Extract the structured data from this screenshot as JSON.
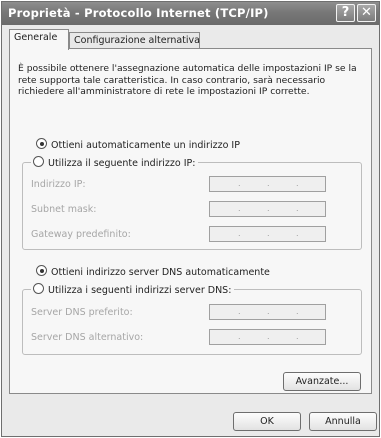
{
  "window": {
    "title": "Proprietà - Protocollo Internet (TCP/IP)",
    "help_glyph": "?",
    "close_glyph": "✕"
  },
  "tabs": [
    {
      "label": "Generale",
      "active": true
    },
    {
      "label": "Configurazione alternativa",
      "active": false
    }
  ],
  "description": "È possibile ottenere l'assegnazione automatica delle impostazioni IP se la rete supporta tale caratteristica. In caso contrario, sarà necessario richiedere all'amministratore di rete le impostazioni IP corrette.",
  "ip": {
    "auto_label": "Ottieni automaticamente un indirizzo IP",
    "auto_selected": true,
    "manual_label": "Utilizza il seguente indirizzo IP:",
    "fields": [
      {
        "label": "Indirizzo IP:",
        "value": ""
      },
      {
        "label": "Subnet mask:",
        "value": ""
      },
      {
        "label": "Gateway predefinito:",
        "value": ""
      }
    ]
  },
  "dns": {
    "auto_label": "Ottieni indirizzo server DNS automaticamente",
    "auto_selected": true,
    "manual_label": "Utilizza i seguenti indirizzi server DNS:",
    "fields": [
      {
        "label": "Server DNS preferito:",
        "value": ""
      },
      {
        "label": "Server DNS alternativo:",
        "value": ""
      }
    ]
  },
  "buttons": {
    "advanced": "Avanzate...",
    "ok": "OK",
    "cancel": "Annulla"
  },
  "ip_separator": "."
}
